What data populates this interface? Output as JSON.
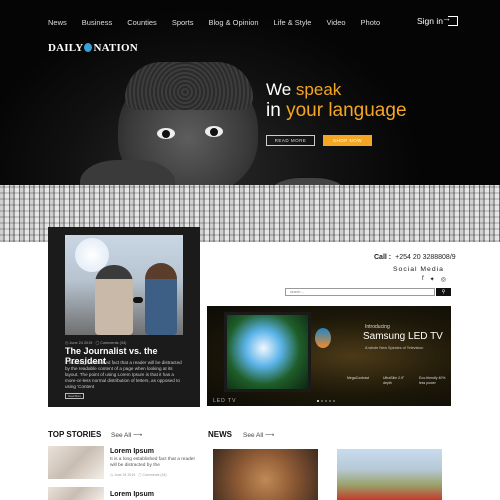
{
  "header": {
    "nav": [
      "News",
      "Business",
      "Counties",
      "Sports",
      "Blog & Opinion",
      "Life & Style",
      "Video",
      "Photo"
    ],
    "signin": "Sign in",
    "logo_left": "DAILY",
    "logo_right": "NATION"
  },
  "hero": {
    "line1_plain": "We ",
    "line1_accent": "speak",
    "line2_plain": "in ",
    "line2_accent": "your language",
    "read_more": "READ MORE",
    "shop_now": "SHOP NOW"
  },
  "feature": {
    "date": "June 24 2019",
    "comments": "Comments (34)",
    "title": "The Journalist vs. the President",
    "text": "It is a long established fact that a reader will be distracted by the readable content of a page when looking at its layout. The point of using Lorem Ipsum is that it has a more-or-less normal distribution of letters, as opposed to using 'Content",
    "button": "Read More"
  },
  "contact": {
    "call_label": "Call :",
    "phone": "+254 20 3288808/9",
    "social_label": "Social Media",
    "search_placeholder": "search ..."
  },
  "ad": {
    "intro": "Introducing",
    "product": "Samsung LED TV",
    "sub": "A whole New Species of Television",
    "features": [
      "MegaContrast",
      "UltraSlim 2.9\" depth",
      "Eco-friendly 40% less power"
    ],
    "brand": "LED TV"
  },
  "top_stories": {
    "title": "TOP STORIES",
    "see_all": "See All ⟶",
    "items": [
      {
        "title": "Lorem Ipsum",
        "text": "It is a long established fact that a reader will be distracted by the",
        "date": "June 24 2019",
        "comments": "Comments (34)"
      },
      {
        "title": "Lorem Ipsum"
      }
    ]
  },
  "news": {
    "title": "NEWS",
    "see_all": "See All ⟶"
  },
  "colors": {
    "accent": "#f5a623",
    "dark": "#1b1b1b"
  }
}
